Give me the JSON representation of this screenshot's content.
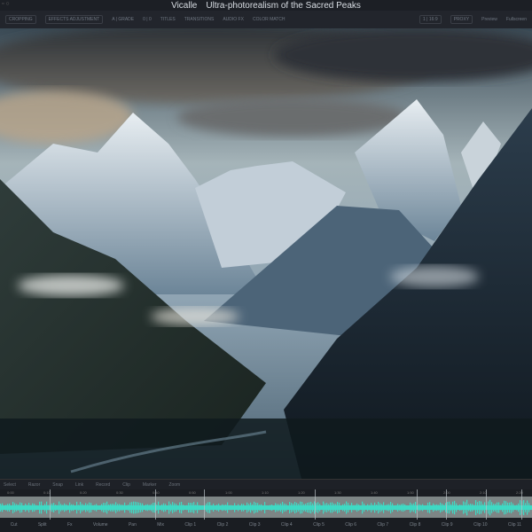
{
  "window": {
    "app_name": "Vicalle",
    "title": "Ultra-photorealism of the Sacred Peaks"
  },
  "toolbar": {
    "items": [
      "CROPPING",
      "EFFECTS ADJUSTMENT",
      "A | GRADE",
      "0 | 0",
      "TITLES",
      "TRANSITIONS",
      "AUDIO FX",
      "COLOR MATCH"
    ],
    "right_items": [
      "1 | 16:9",
      "PROXY",
      "Preview",
      "Fullscreen"
    ]
  },
  "timeline": {
    "tools": [
      "Select",
      "Razor",
      "Snap",
      "Link",
      "Record",
      "Clip",
      "Marker",
      "Zoom"
    ],
    "ruler_labels": [
      "0:00",
      "0:10",
      "0:20",
      "0:30",
      "0:40",
      "0:50",
      "1:00",
      "1:10",
      "1:20",
      "1:30",
      "1:40",
      "1:50",
      "2:00",
      "2:10",
      "2:20"
    ],
    "bottom_labels": [
      "Cut",
      "Split",
      "Fx",
      "Volume",
      "Pan",
      "Mix",
      "Clip 1",
      "Clip 2",
      "Clip 3",
      "Clip 4",
      "Clip 5",
      "Clip 6",
      "Clip 7",
      "Clip 8",
      "Clip 9",
      "Clip 10",
      "Clip 11"
    ],
    "colors": {
      "waveform": "#3fd9c4",
      "track": "#7d8585"
    }
  }
}
